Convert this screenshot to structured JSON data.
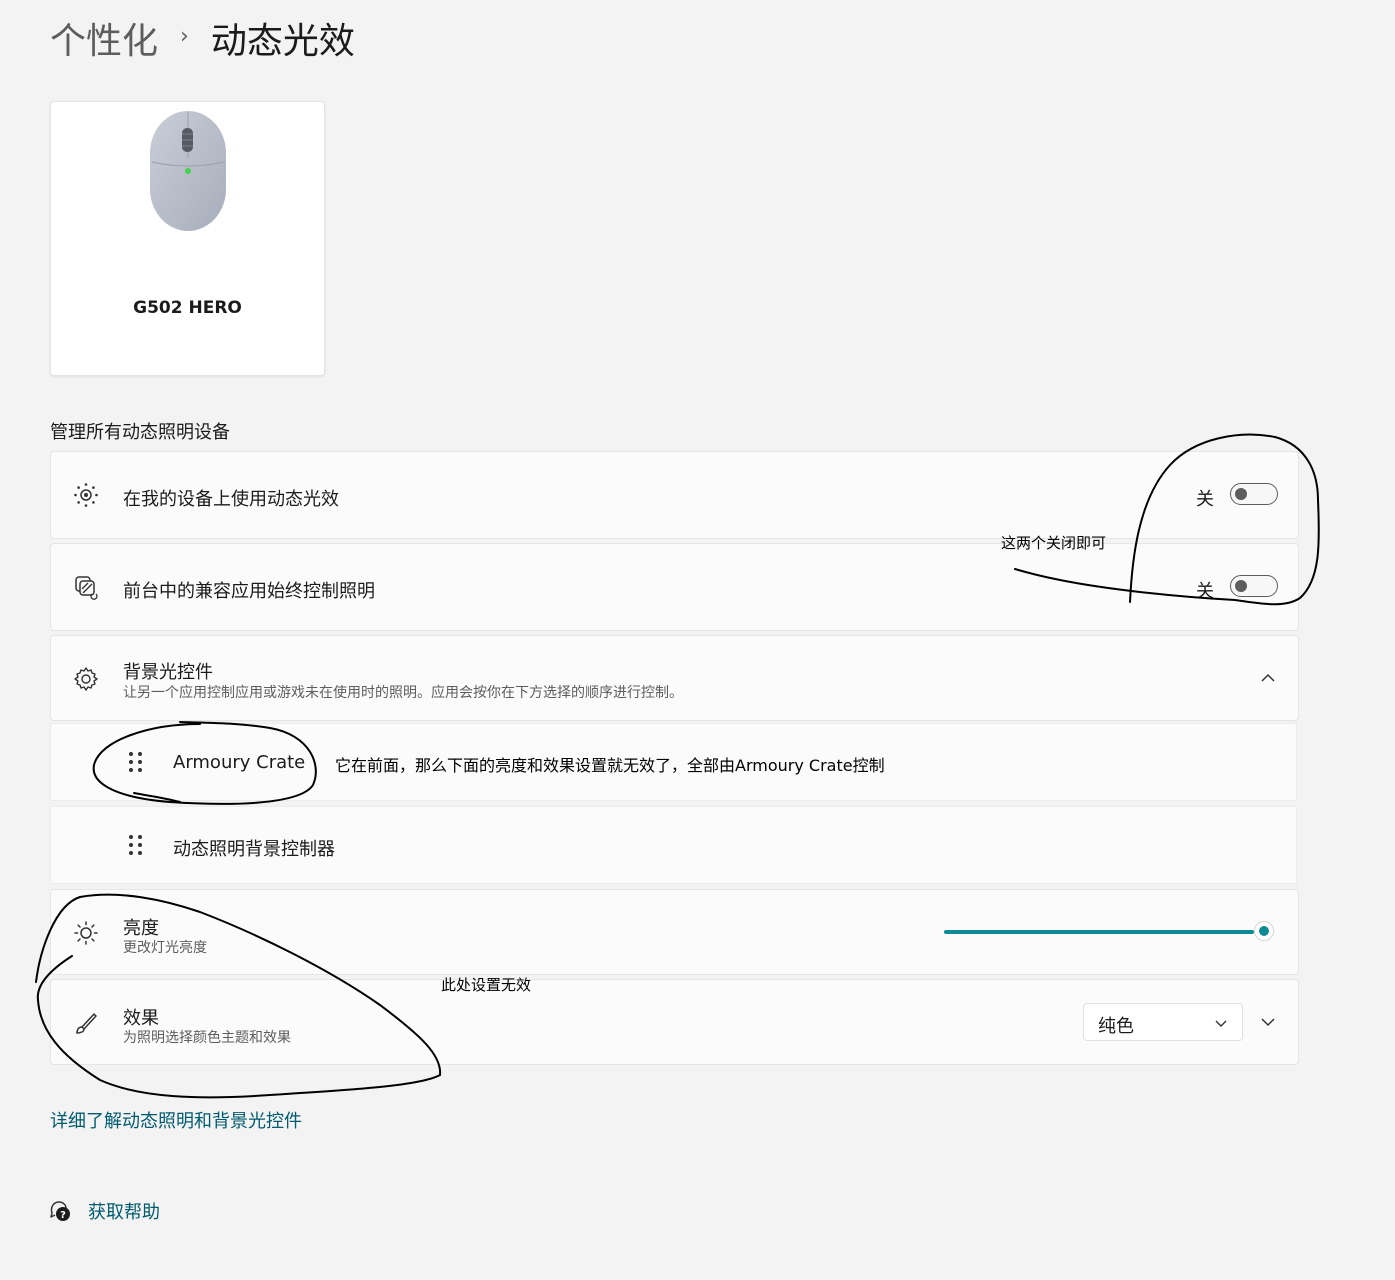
{
  "breadcrumb": {
    "parent": "个性化",
    "separator": "›",
    "current": "动态光效"
  },
  "device": {
    "name": "G502 HERO",
    "icon": "mouse-icon"
  },
  "section_title": "管理所有动态照明设备",
  "settings": {
    "use_dynamic_lighting": {
      "icon": "sun-dots-icon",
      "title": "在我的设备上使用动态光效",
      "state": "关",
      "on": false
    },
    "foreground_apps": {
      "icon": "app-control-icon",
      "title": "前台中的兼容应用始终控制照明",
      "state": "关",
      "on": false
    },
    "ambient_controls": {
      "icon": "gear-icon",
      "title": "背景光控件",
      "subtitle": "让另一个应用控制应用或游戏未在使用时的照明。应用会按你在下方选择的顺序进行控制。",
      "expanded": true,
      "items": [
        {
          "label": "Armoury Crate"
        },
        {
          "label": "动态照明背景控制器"
        }
      ]
    },
    "brightness": {
      "icon": "brightness-icon",
      "title": "亮度",
      "subtitle": "更改灯光亮度",
      "value_fraction": 1.0
    },
    "effects": {
      "icon": "brush-icon",
      "title": "效果",
      "subtitle": "为照明选择颜色主题和效果",
      "selected": "纯色"
    }
  },
  "links": {
    "learn_more": "详细了解动态照明和背景光控件",
    "get_help": "获取帮助"
  },
  "annotations": {
    "toggles_note": "这两个关闭即可",
    "armoury_note": "它在前面，那么下面的亮度和效果设置就无效了，全部由Armoury Crate控制",
    "settings_note": "此处设置无效"
  },
  "colors": {
    "accent": "#0e8a96",
    "link": "#005b70",
    "page_bg": "#f3f3f3",
    "card_bg": "#fbfbfb"
  }
}
